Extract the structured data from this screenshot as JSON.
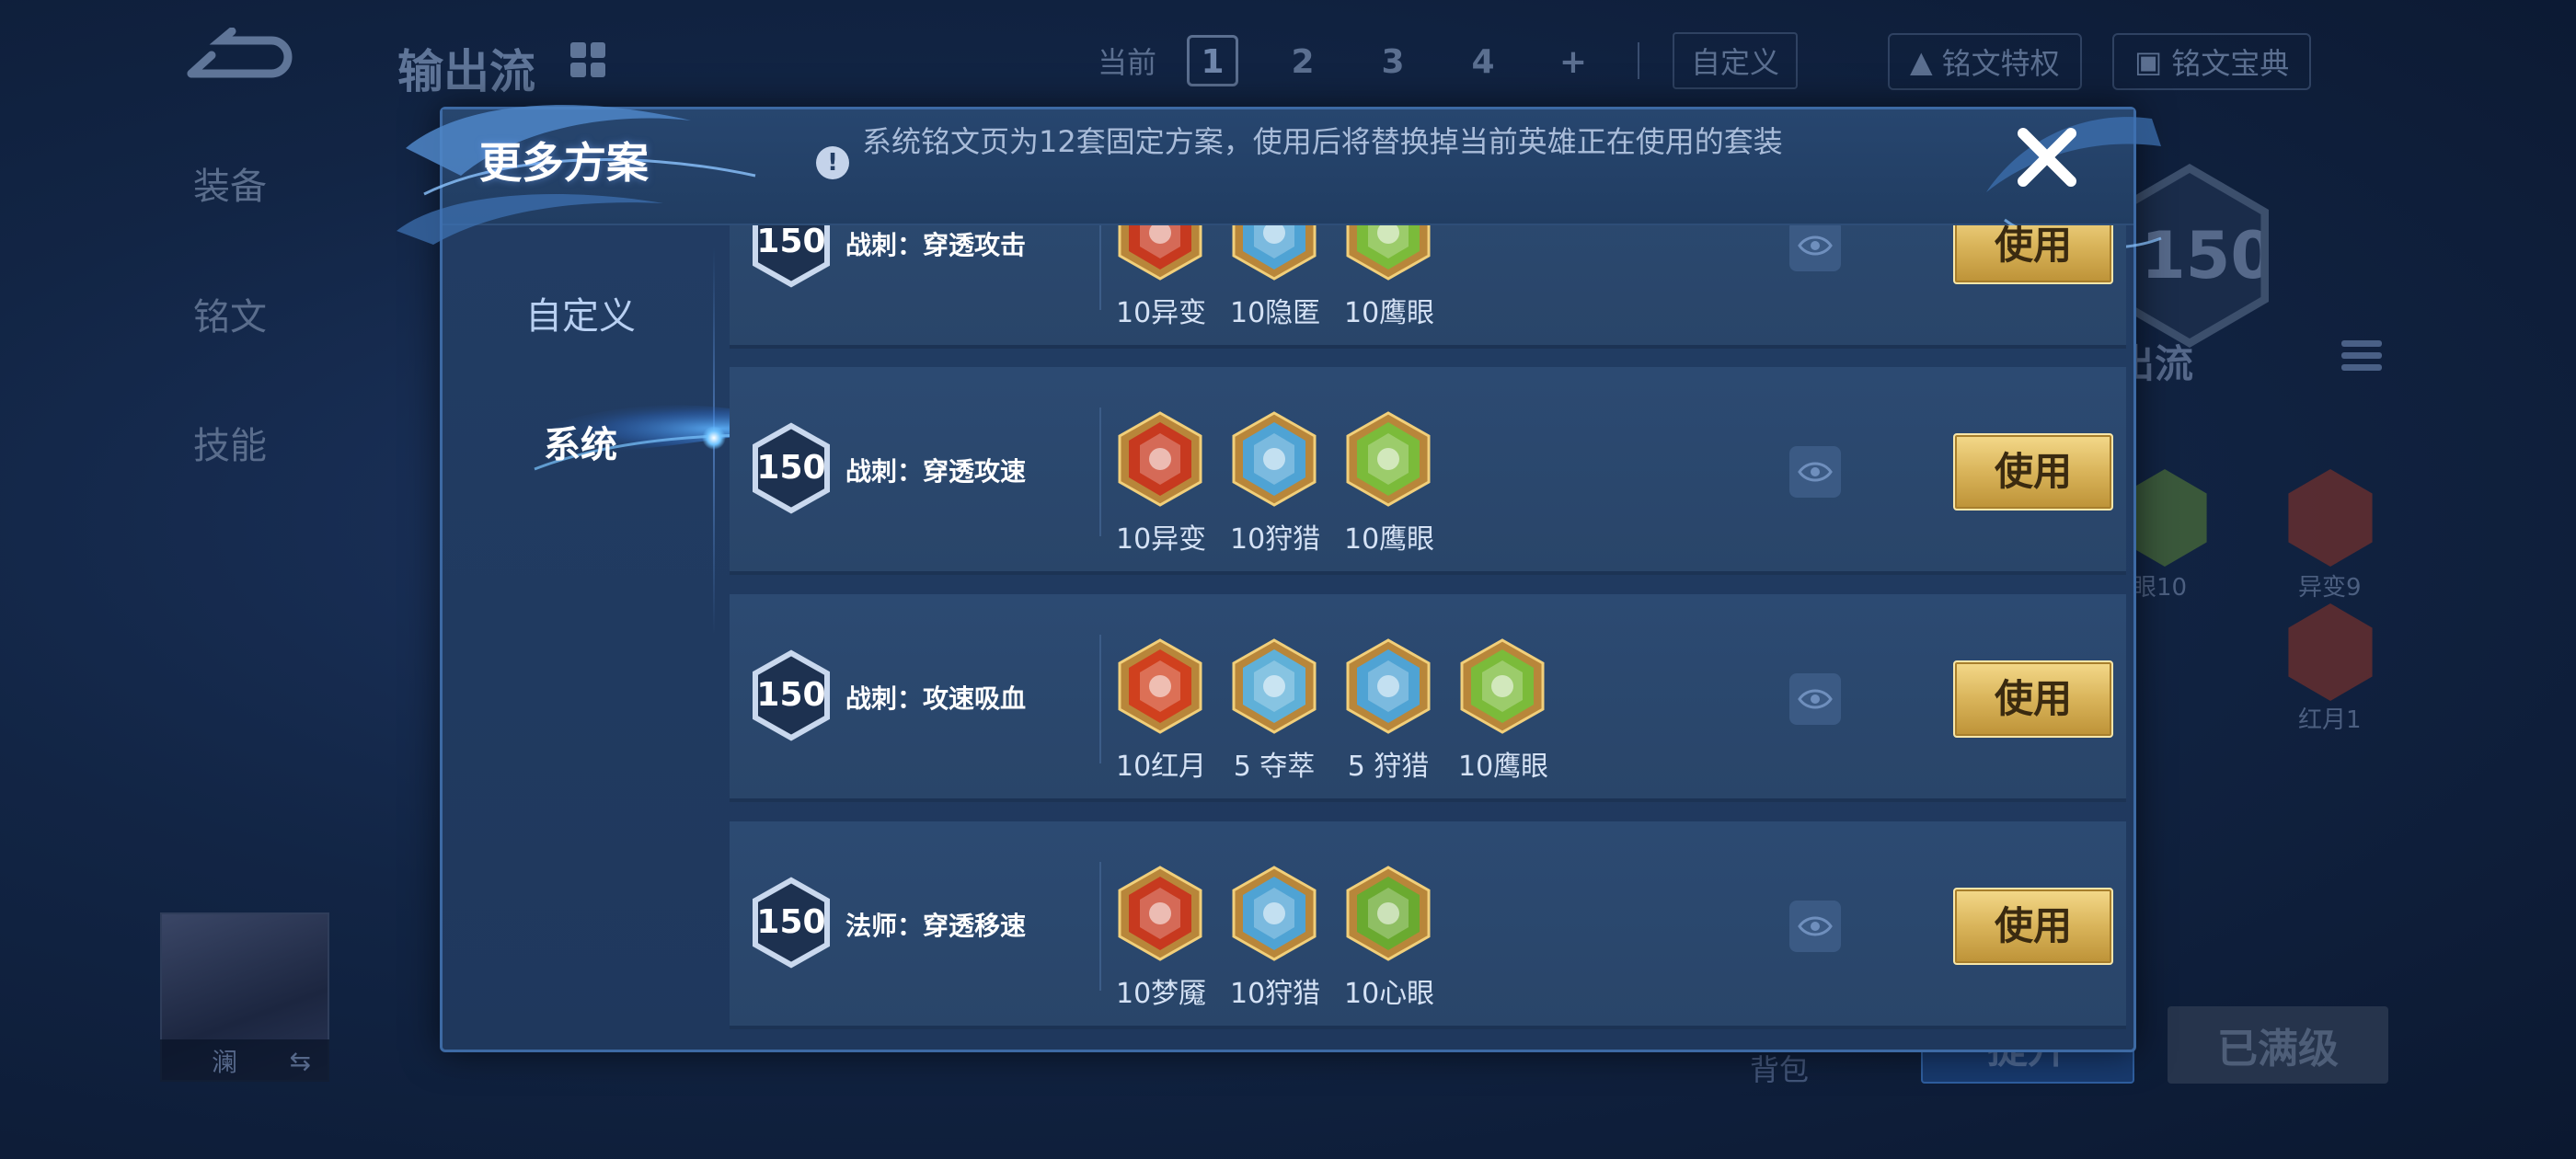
{
  "background": {
    "title": "输出流",
    "tabs": {
      "current_label": "当前",
      "slots": [
        "1",
        "2",
        "3",
        "4",
        "+"
      ],
      "custom_label": "自定义"
    },
    "chips": [
      "铭文特权",
      "铭文宝典"
    ],
    "sidebar": [
      "装备",
      "铭文",
      "技能"
    ],
    "hero_level": "150",
    "hero_subtitle": "出流",
    "rune_labels": [
      "眼10",
      "异变9",
      "红月1"
    ],
    "avatar_name": "澜",
    "bag_label": "背包",
    "upgrade_label": "提升",
    "maxed_label": "已满级"
  },
  "modal": {
    "title": "更多方案",
    "notice": "系统铭文页为12套固定方案，使用后将替换掉当前英雄正在使用的套装",
    "tabs": [
      {
        "label": "自定义",
        "active": false
      },
      {
        "label": "系统",
        "active": true
      }
    ],
    "rows": [
      {
        "level": "150",
        "name": "战刺：穿透攻击",
        "runes": [
          {
            "label": "10异变",
            "icon": "red-rune-icon",
            "color": "#c7391f"
          },
          {
            "label": "10隐匿",
            "icon": "blue-rune-icon",
            "color": "#4fa3d4"
          },
          {
            "label": "10鹰眼",
            "icon": "green-rune-icon",
            "color": "#7bbb3a"
          }
        ],
        "action": "使用"
      },
      {
        "level": "150",
        "name": "战刺：穿透攻速",
        "runes": [
          {
            "label": "10异变",
            "icon": "red-rune-icon",
            "color": "#c7391f"
          },
          {
            "label": "10狩猎",
            "icon": "blue-rune-icon",
            "color": "#4fa3d4"
          },
          {
            "label": "10鹰眼",
            "icon": "green-rune-icon",
            "color": "#7bbb3a"
          }
        ],
        "action": "使用"
      },
      {
        "level": "150",
        "name": "战刺：攻速吸血",
        "runes": [
          {
            "label": "10红月",
            "icon": "red-rune-icon",
            "color": "#d0401e"
          },
          {
            "label": "5 夺萃",
            "icon": "blue-rune-icon",
            "color": "#5fb0d8"
          },
          {
            "label": "5 狩猎",
            "icon": "blue-rune-icon",
            "color": "#4fa3d4"
          },
          {
            "label": "10鹰眼",
            "icon": "green-rune-icon",
            "color": "#7bbb3a"
          }
        ],
        "action": "使用"
      },
      {
        "level": "150",
        "name": "法师：穿透移速",
        "runes": [
          {
            "label": "10梦魇",
            "icon": "red-rune-icon",
            "color": "#c7391f"
          },
          {
            "label": "10狩猎",
            "icon": "blue-rune-icon",
            "color": "#4fa3d4"
          },
          {
            "label": "10心眼",
            "icon": "green-rune-icon",
            "color": "#6aaa30"
          }
        ],
        "action": "使用"
      }
    ]
  },
  "colors": {
    "gold": "#d9b45a",
    "panel": "#223d64",
    "row": "#2c4a72"
  }
}
